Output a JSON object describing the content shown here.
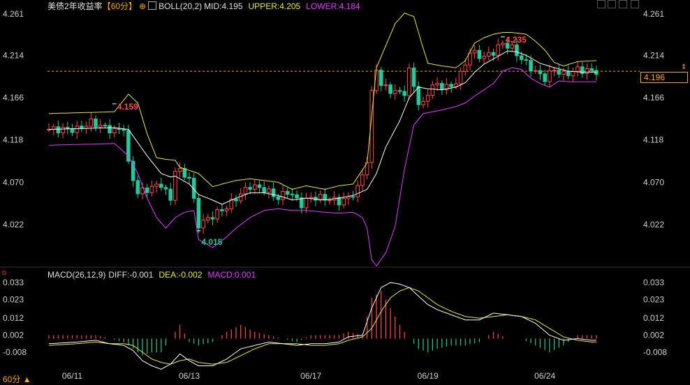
{
  "header": {
    "instrument": "美债2年收益率",
    "period": "【60分】",
    "indicator": "BOLL(20,2)",
    "mid": "MID:4.195",
    "upper": "UPPER:4.205",
    "lower": "LOWER:4.184"
  },
  "macd_header": {
    "name": "MACD(26,12,9)",
    "diff": "DIFF:-0.001",
    "dea": "DEA:-0.002",
    "macd": "MACD:0.001"
  },
  "current_price": "4.196",
  "period_selector": "60分",
  "colors": {
    "up": "#ff4d4d",
    "down": "#26c99a",
    "upper": "#e8e84a",
    "mid": "#ffffff",
    "lower": "#e040fb",
    "dea": "#e8e84a",
    "diff": "#ffffff",
    "accent": "#f5a623"
  },
  "chart_data": [
    {
      "type": "candlestick",
      "title": "美债2年收益率",
      "y_ticks": [
        "4.261",
        "4.214",
        "4.166",
        "4.118",
        "4.070",
        "4.022"
      ],
      "ylim": [
        3.975,
        4.275
      ],
      "x_ticks": [
        {
          "label": "06/11",
          "i": 5
        },
        {
          "label": "06/13",
          "i": 30
        },
        {
          "label": "06/17",
          "i": 56
        },
        {
          "label": "06/19",
          "i": 81
        },
        {
          "label": "06/24",
          "i": 106
        }
      ],
      "bar_count": 122,
      "annotations": [
        {
          "text": "4.159",
          "i": 14,
          "value": 4.159,
          "kind": "high"
        },
        {
          "text": "4.015",
          "i": 32,
          "value": 4.015,
          "kind": "low"
        },
        {
          "text": "4.235",
          "i": 97,
          "value": 4.235,
          "kind": "high"
        }
      ],
      "close_anchors": [
        [
          0,
          4.13
        ],
        [
          6,
          4.13
        ],
        [
          9,
          4.138
        ],
        [
          14,
          4.128
        ],
        [
          16,
          4.132
        ],
        [
          17,
          4.09
        ],
        [
          19,
          4.058
        ],
        [
          21,
          4.062
        ],
        [
          24,
          4.068
        ],
        [
          26,
          4.05
        ],
        [
          27,
          4.085
        ],
        [
          30,
          4.075
        ],
        [
          32,
          4.022
        ],
        [
          35,
          4.032
        ],
        [
          38,
          4.042
        ],
        [
          40,
          4.052
        ],
        [
          43,
          4.066
        ],
        [
          46,
          4.062
        ],
        [
          49,
          4.052
        ],
        [
          51,
          4.06
        ],
        [
          54,
          4.045
        ],
        [
          56,
          4.053
        ],
        [
          59,
          4.052
        ],
        [
          62,
          4.048
        ],
        [
          64,
          4.052
        ],
        [
          66,
          4.063
        ],
        [
          68,
          4.095
        ],
        [
          69,
          4.17
        ],
        [
          70,
          4.2
        ],
        [
          71,
          4.18
        ],
        [
          74,
          4.172
        ],
        [
          76,
          4.172
        ],
        [
          77,
          4.196
        ],
        [
          78,
          4.18
        ],
        [
          79,
          4.16
        ],
        [
          80,
          4.158
        ],
        [
          81,
          4.172
        ],
        [
          82,
          4.18
        ],
        [
          86,
          4.178
        ],
        [
          88,
          4.192
        ],
        [
          90,
          4.218
        ],
        [
          93,
          4.212
        ],
        [
          95,
          4.218
        ],
        [
          97,
          4.228
        ],
        [
          99,
          4.222
        ],
        [
          101,
          4.21
        ],
        [
          104,
          4.195
        ],
        [
          106,
          4.188
        ],
        [
          108,
          4.198
        ],
        [
          110,
          4.192
        ],
        [
          113,
          4.198
        ],
        [
          116,
          4.196
        ],
        [
          117,
          4.196
        ]
      ],
      "bollinger": {
        "upper": [
          [
            0,
            4.148
          ],
          [
            14,
            4.15
          ],
          [
            17,
            4.17
          ],
          [
            19,
            4.16
          ],
          [
            21,
            4.125
          ],
          [
            23,
            4.098
          ],
          [
            25,
            4.096
          ],
          [
            27,
            4.095
          ],
          [
            28,
            4.087
          ],
          [
            32,
            4.08
          ],
          [
            34,
            4.07
          ],
          [
            35,
            4.065
          ],
          [
            37,
            4.068
          ],
          [
            40,
            4.072
          ],
          [
            43,
            4.074
          ],
          [
            46,
            4.072
          ],
          [
            49,
            4.07
          ],
          [
            52,
            4.062
          ],
          [
            55,
            4.066
          ],
          [
            59,
            4.062
          ],
          [
            62,
            4.066
          ],
          [
            65,
            4.068
          ],
          [
            68,
            4.092
          ],
          [
            70,
            4.2
          ],
          [
            72,
            4.225
          ],
          [
            74,
            4.25
          ],
          [
            76,
            4.262
          ],
          [
            78,
            4.258
          ],
          [
            80,
            4.222
          ],
          [
            81,
            4.205
          ],
          [
            84,
            4.202
          ],
          [
            87,
            4.2
          ],
          [
            89,
            4.208
          ],
          [
            91,
            4.228
          ],
          [
            93,
            4.234
          ],
          [
            95,
            4.238
          ],
          [
            97,
            4.24
          ],
          [
            99,
            4.24
          ],
          [
            102,
            4.238
          ],
          [
            104,
            4.23
          ],
          [
            106,
            4.22
          ],
          [
            108,
            4.206
          ],
          [
            110,
            4.202
          ],
          [
            113,
            4.207
          ],
          [
            117,
            4.208
          ]
        ],
        "mid": [
          [
            0,
            4.13
          ],
          [
            14,
            4.132
          ],
          [
            17,
            4.13
          ],
          [
            19,
            4.115
          ],
          [
            21,
            4.1
          ],
          [
            24,
            4.08
          ],
          [
            26,
            4.076
          ],
          [
            27,
            4.077
          ],
          [
            30,
            4.068
          ],
          [
            32,
            4.056
          ],
          [
            34,
            4.052
          ],
          [
            37,
            4.045
          ],
          [
            40,
            4.052
          ],
          [
            43,
            4.058
          ],
          [
            46,
            4.058
          ],
          [
            49,
            4.055
          ],
          [
            52,
            4.05
          ],
          [
            55,
            4.052
          ],
          [
            59,
            4.05
          ],
          [
            62,
            4.052
          ],
          [
            65,
            4.055
          ],
          [
            68,
            4.062
          ],
          [
            70,
            4.08
          ],
          [
            72,
            4.11
          ],
          [
            75,
            4.14
          ],
          [
            77,
            4.166
          ],
          [
            79,
            4.178
          ],
          [
            81,
            4.176
          ],
          [
            84,
            4.175
          ],
          [
            87,
            4.178
          ],
          [
            89,
            4.183
          ],
          [
            91,
            4.195
          ],
          [
            93,
            4.204
          ],
          [
            95,
            4.21
          ],
          [
            98,
            4.219
          ],
          [
            100,
            4.218
          ],
          [
            102,
            4.214
          ],
          [
            105,
            4.205
          ],
          [
            108,
            4.2
          ],
          [
            111,
            4.196
          ],
          [
            114,
            4.195
          ],
          [
            117,
            4.195
          ]
        ],
        "lower": [
          [
            0,
            4.112
          ],
          [
            14,
            4.114
          ],
          [
            17,
            4.1
          ],
          [
            19,
            4.08
          ],
          [
            21,
            4.052
          ],
          [
            23,
            4.03
          ],
          [
            25,
            4.018
          ],
          [
            27,
            4.03
          ],
          [
            29,
            4.036
          ],
          [
            31,
            4.038
          ],
          [
            32,
            4.005
          ],
          [
            35,
            3.996
          ],
          [
            38,
            4.008
          ],
          [
            40,
            4.018
          ],
          [
            43,
            4.03
          ],
          [
            46,
            4.038
          ],
          [
            49,
            4.04
          ],
          [
            52,
            4.038
          ],
          [
            55,
            4.038
          ],
          [
            59,
            4.036
          ],
          [
            62,
            4.035
          ],
          [
            65,
            4.036
          ],
          [
            67,
            4.03
          ],
          [
            68,
            4.018
          ],
          [
            69,
            3.982
          ],
          [
            70,
            3.975
          ],
          [
            72,
            3.99
          ],
          [
            74,
            4.02
          ],
          [
            76,
            4.085
          ],
          [
            78,
            4.135
          ],
          [
            80,
            4.148
          ],
          [
            84,
            4.152
          ],
          [
            87,
            4.156
          ],
          [
            89,
            4.16
          ],
          [
            91,
            4.168
          ],
          [
            93,
            4.175
          ],
          [
            95,
            4.182
          ],
          [
            97,
            4.196
          ],
          [
            99,
            4.2
          ],
          [
            101,
            4.198
          ],
          [
            103,
            4.188
          ],
          [
            105,
            4.182
          ],
          [
            107,
            4.178
          ],
          [
            109,
            4.185
          ],
          [
            112,
            4.184
          ],
          [
            117,
            4.184
          ]
        ]
      }
    },
    {
      "type": "macd",
      "title": "MACD(26,12,9)",
      "y_ticks": [
        "0.033",
        "0.023",
        "0.012",
        "0.002",
        "-0.008"
      ],
      "ylim": [
        -0.016,
        0.035
      ],
      "diff": [
        [
          0,
          -0.003
        ],
        [
          6,
          -0.002
        ],
        [
          10,
          -0.001
        ],
        [
          13,
          -0.003
        ],
        [
          16,
          -0.004
        ],
        [
          18,
          -0.007
        ],
        [
          20,
          -0.013
        ],
        [
          22,
          -0.016
        ],
        [
          24,
          -0.018
        ],
        [
          26,
          -0.015
        ],
        [
          28,
          -0.009
        ],
        [
          30,
          -0.013
        ],
        [
          32,
          -0.016
        ],
        [
          35,
          -0.016
        ],
        [
          38,
          -0.012
        ],
        [
          41,
          -0.006
        ],
        [
          44,
          -0.004
        ],
        [
          47,
          -0.002
        ],
        [
          50,
          -0.003
        ],
        [
          53,
          -0.004
        ],
        [
          56,
          -0.003
        ],
        [
          59,
          -0.003
        ],
        [
          62,
          -0.002
        ],
        [
          64,
          0.001
        ],
        [
          67,
          0.002
        ],
        [
          69,
          0.018
        ],
        [
          71,
          0.03
        ],
        [
          73,
          0.033
        ],
        [
          75,
          0.032
        ],
        [
          77,
          0.03
        ],
        [
          79,
          0.025
        ],
        [
          81,
          0.02
        ],
        [
          83,
          0.017
        ],
        [
          86,
          0.014
        ],
        [
          89,
          0.011
        ],
        [
          92,
          0.011
        ],
        [
          95,
          0.015
        ],
        [
          98,
          0.014
        ],
        [
          101,
          0.013
        ],
        [
          104,
          0.009
        ],
        [
          107,
          0.002
        ],
        [
          110,
          -0.001
        ],
        [
          113,
          0.0
        ],
        [
          116,
          -0.001
        ],
        [
          117,
          -0.001
        ]
      ],
      "dea": [
        [
          0,
          -0.004
        ],
        [
          6,
          -0.003
        ],
        [
          10,
          -0.002
        ],
        [
          13,
          -0.003
        ],
        [
          16,
          -0.003
        ],
        [
          18,
          -0.004
        ],
        [
          20,
          -0.008
        ],
        [
          22,
          -0.012
        ],
        [
          24,
          -0.014
        ],
        [
          26,
          -0.015
        ],
        [
          28,
          -0.013
        ],
        [
          30,
          -0.012
        ],
        [
          32,
          -0.014
        ],
        [
          35,
          -0.015
        ],
        [
          38,
          -0.014
        ],
        [
          41,
          -0.01
        ],
        [
          44,
          -0.006
        ],
        [
          47,
          -0.003
        ],
        [
          50,
          -0.003
        ],
        [
          53,
          -0.003
        ],
        [
          56,
          -0.004
        ],
        [
          59,
          -0.004
        ],
        [
          62,
          -0.003
        ],
        [
          64,
          -0.001
        ],
        [
          67,
          0.001
        ],
        [
          69,
          0.006
        ],
        [
          71,
          0.016
        ],
        [
          73,
          0.024
        ],
        [
          75,
          0.028
        ],
        [
          77,
          0.03
        ],
        [
          79,
          0.028
        ],
        [
          81,
          0.024
        ],
        [
          83,
          0.02
        ],
        [
          86,
          0.016
        ],
        [
          89,
          0.013
        ],
        [
          92,
          0.012
        ],
        [
          95,
          0.013
        ],
        [
          98,
          0.014
        ],
        [
          101,
          0.013
        ],
        [
          104,
          0.011
        ],
        [
          107,
          0.006
        ],
        [
          110,
          0.001
        ],
        [
          113,
          -0.001
        ],
        [
          116,
          -0.002
        ],
        [
          117,
          -0.002
        ]
      ]
    }
  ]
}
